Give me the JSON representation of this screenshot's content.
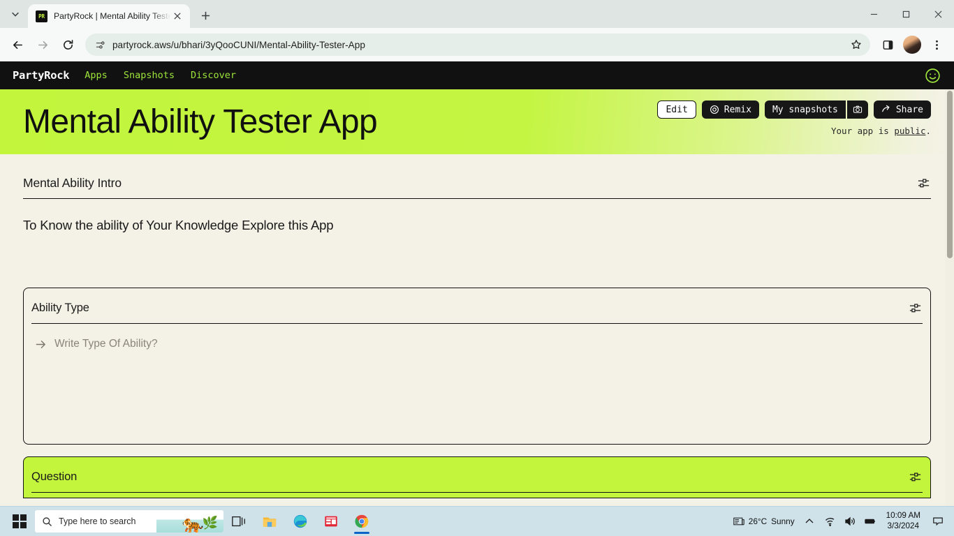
{
  "browser": {
    "tab": {
      "favicon_text": "PR",
      "title": "PartyRock | Mental Ability Teste",
      "close_icon": "close-icon"
    },
    "new_tab_label": "+",
    "window_controls": [
      "minimize",
      "maximize",
      "close"
    ],
    "nav": {
      "back": "back-arrow-icon",
      "forward": "forward-arrow-icon",
      "reload": "reload-icon"
    },
    "omnibox": {
      "site_icon": "page-settings-icon",
      "url": "partyrock.aws/u/bhari/3yQooCUNI/Mental-Ability-Tester-App",
      "star": "bookmark-star-icon"
    },
    "side_panel": "side-panel-icon",
    "profile": "profile-avatar",
    "menu": "three-dot-menu-icon"
  },
  "partyrock": {
    "logo": "PartyRock",
    "nav_links": [
      "Apps",
      "Snapshots",
      "Discover"
    ],
    "smiley": "smiley-face-icon",
    "hero": {
      "title": "Mental Ability Tester App",
      "buttons": {
        "edit": "Edit",
        "remix": "Remix",
        "my_snapshots": "My snapshots",
        "camera": "camera-icon",
        "share": "Share"
      },
      "visibility_prefix": "Your app is ",
      "visibility_value": "public",
      "visibility_suffix": "."
    },
    "widgets": [
      {
        "title": "Mental Ability Intro",
        "body": "To Know the ability of Your Knowledge Explore this App",
        "settings_icon": "sliders-icon"
      },
      {
        "title": "Ability Type",
        "placeholder": "Write Type Of Ability?",
        "submit_icon": "arrow-right-icon",
        "settings_icon": "sliders-icon"
      },
      {
        "title": "Question",
        "settings_icon": "sliders-icon"
      }
    ]
  },
  "taskbar": {
    "start": "windows-logo-icon",
    "search_placeholder": "Type here to search",
    "search_icon": "search-icon",
    "apps": [
      {
        "name": "task-view-icon"
      },
      {
        "name": "file-explorer-icon"
      },
      {
        "name": "microsoft-edge-icon"
      },
      {
        "name": "microsoft-store-icon"
      },
      {
        "name": "google-chrome-icon"
      }
    ],
    "tray": {
      "weather_icon": "news-weather-icon",
      "weather_temp": "26°C",
      "weather_condition": "Sunny",
      "chevron": "chevron-up-icon",
      "network": "wifi-icon",
      "volume": "volume-icon",
      "battery": "battery-icon",
      "time": "10:09 AM",
      "date": "3/3/2024",
      "notifications": "notification-icon"
    }
  },
  "colors": {
    "lime": "#c2f53c",
    "cream": "#f4f1e6",
    "nav_dark": "#111111",
    "nav_green": "#9ee53b"
  }
}
